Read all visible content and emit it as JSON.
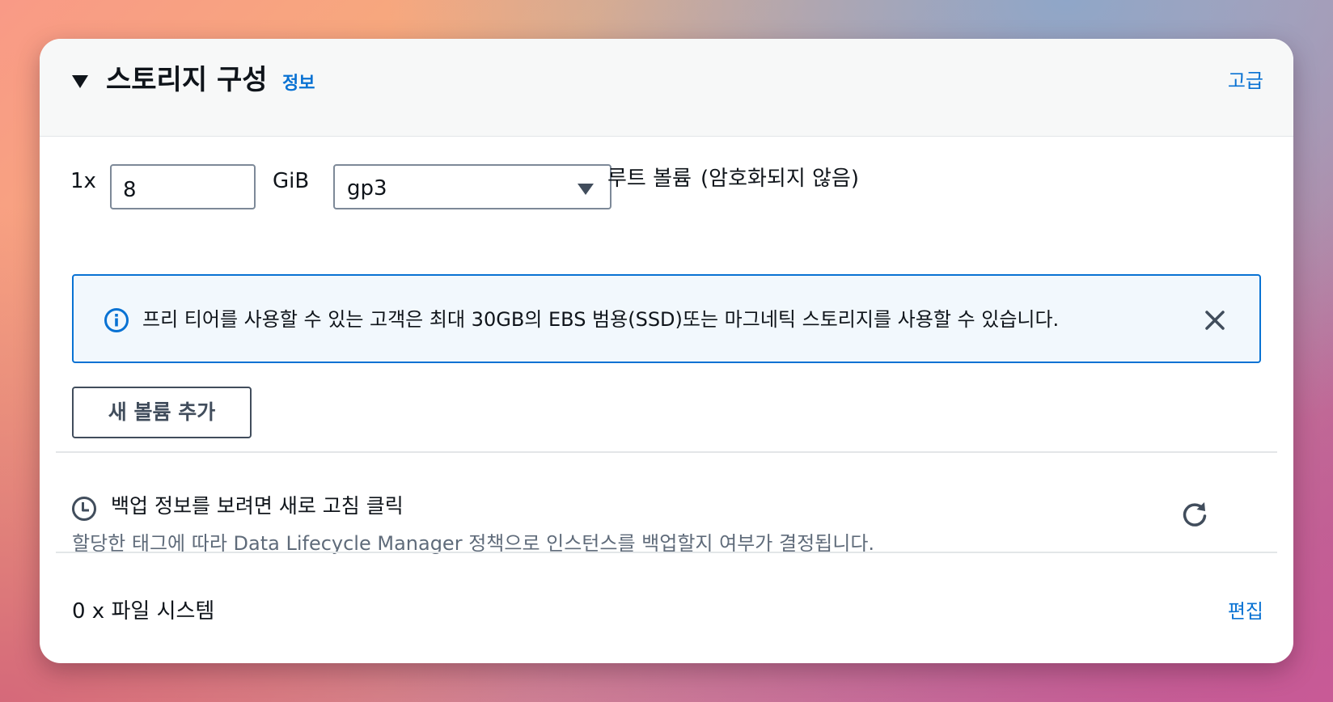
{
  "header": {
    "title": "스토리지 구성",
    "info_link": "정보",
    "advanced_link": "고급"
  },
  "root_volume": {
    "count": "1x",
    "size_value": "8",
    "size_unit": "GiB",
    "volume_type": "gp3",
    "label": "루트 볼륨",
    "encryption": "(암호화되지 않음)"
  },
  "alert": {
    "text": "프리 티어를 사용할 수 있는 고객은 최대 30GB의 EBS 범용(SSD)또는 마그네틱 스토리지를 사용할 수 있습니다.",
    "icon": "info-circle-icon",
    "close_icon": "close-icon"
  },
  "add_volume_button": "새 볼륨 추가",
  "backup": {
    "title": "백업 정보를 보려면 새로 고침 클릭",
    "description": "할당한 태그에 따라 Data Lifecycle Manager 정책으로 인스턴스를 백업할지 여부가 결정됩니다.",
    "icon": "clock-icon",
    "refresh_icon": "refresh-icon"
  },
  "file_systems": {
    "label": "0 x 파일 시스템",
    "edit_link": "편집"
  },
  "colors": {
    "link_blue": "#0972d3",
    "alert_border": "#0972d3",
    "alert_background": "#f2f8fd",
    "text_primary": "#0f141a",
    "text_secondary": "#5f6b7a"
  }
}
